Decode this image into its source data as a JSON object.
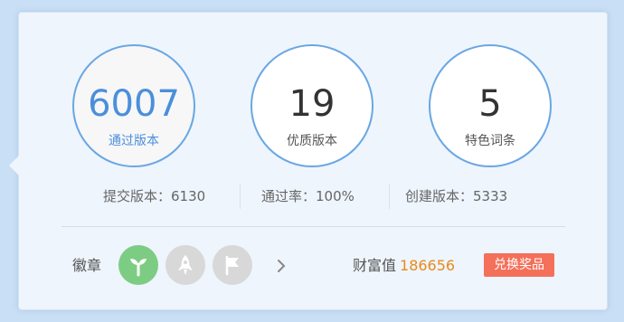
{
  "stats": [
    {
      "value": "6007",
      "label": "通过版本"
    },
    {
      "value": "19",
      "label": "优质版本"
    },
    {
      "value": "5",
      "label": "特色词条"
    }
  ],
  "sub_stats": {
    "submitted": "提交版本：6130",
    "pass_rate": "通过率：100%",
    "created": "创建版本：5333"
  },
  "badges": {
    "label": "徽章",
    "items": [
      {
        "icon": "sprout-icon",
        "state": "earned",
        "color": "#7dcc83"
      },
      {
        "icon": "rocket-icon",
        "state": "locked",
        "color": "#d8d8d8"
      },
      {
        "icon": "flag-icon",
        "state": "locked",
        "color": "#d8d8d8"
      }
    ],
    "more_icon": "chevron-right-icon"
  },
  "wealth": {
    "label": "财富值",
    "value": "186656"
  },
  "redeem_button": "兑换奖品",
  "colors": {
    "accent_blue": "#4a8fdc",
    "circle_border": "#6aa7e3",
    "wealth_orange": "#e98a1b",
    "redeem_red": "#f4705a"
  }
}
